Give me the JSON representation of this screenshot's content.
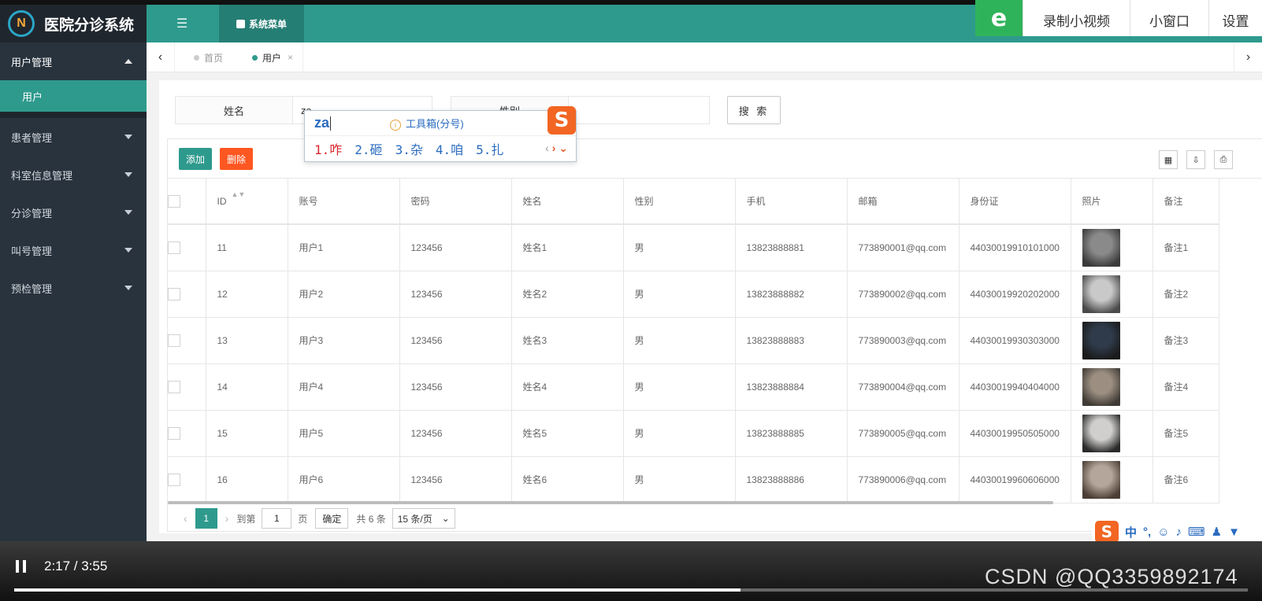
{
  "app": {
    "title": "医院分诊系统",
    "logo_glyph": "N"
  },
  "sidebar": {
    "groups": [
      {
        "label": "用户管理",
        "open": true,
        "children": [
          {
            "label": "用户"
          }
        ]
      },
      {
        "label": "患者管理"
      },
      {
        "label": "科室信息管理"
      },
      {
        "label": "分诊管理"
      },
      {
        "label": "叫号管理"
      },
      {
        "label": "预检管理"
      }
    ]
  },
  "header": {
    "menu_tab": "系统菜单"
  },
  "recorder": {
    "logo": "e",
    "record_label": "录制小视频",
    "mini_label": "小窗口",
    "settings_label": "设置"
  },
  "tabs": {
    "items": [
      {
        "label": "首页"
      },
      {
        "label": "用户"
      }
    ],
    "close": "×"
  },
  "search": {
    "name_label": "姓名",
    "name_value": "za",
    "gender_label": "性别",
    "gender_value": "",
    "button": "搜 索"
  },
  "toolbar": {
    "add": "添加",
    "delete": "删除"
  },
  "table": {
    "columns": [
      "ID",
      "账号",
      "密码",
      "姓名",
      "性别",
      "手机",
      "邮箱",
      "身份证",
      "照片",
      "备注"
    ],
    "rows": [
      [
        "11",
        "用户1",
        "123456",
        "姓名1",
        "男",
        "13823888881",
        "773890001@qq.com",
        "44030019910101000",
        "",
        "备注1"
      ],
      [
        "12",
        "用户2",
        "123456",
        "姓名2",
        "男",
        "13823888882",
        "773890002@qq.com",
        "44030019920202000",
        "",
        "备注2"
      ],
      [
        "13",
        "用户3",
        "123456",
        "姓名3",
        "男",
        "13823888883",
        "773890003@qq.com",
        "44030019930303000",
        "",
        "备注3"
      ],
      [
        "14",
        "用户4",
        "123456",
        "姓名4",
        "男",
        "13823888884",
        "773890004@qq.com",
        "44030019940404000",
        "",
        "备注4"
      ],
      [
        "15",
        "用户5",
        "123456",
        "姓名5",
        "男",
        "13823888885",
        "773890005@qq.com",
        "44030019950505000",
        "",
        "备注5"
      ],
      [
        "16",
        "用户6",
        "123456",
        "姓名6",
        "男",
        "13823888886",
        "773890006@qq.com",
        "44030019960606000",
        "",
        "备注6"
      ]
    ]
  },
  "pager": {
    "current": "1",
    "goto_label": "到第",
    "goto_value": "1",
    "page_unit": "页",
    "ok": "确定",
    "total": "共 6 条",
    "page_size": "15 条/页"
  },
  "ime": {
    "composition": "za",
    "toolbox": "工具箱(分号)",
    "candidates": [
      "1.咋",
      "2.砸",
      "3.杂",
      "4.咱",
      "5.扎"
    ],
    "logo": "S",
    "status_mode": "中",
    "status_punct": "°,"
  },
  "video": {
    "time": "2:17 / 3:55",
    "watermark": "CSDN @QQ3359892174"
  },
  "colors": {
    "accent": "#2e9a8d",
    "sidebar": "#28333e",
    "danger": "#ff5722"
  }
}
